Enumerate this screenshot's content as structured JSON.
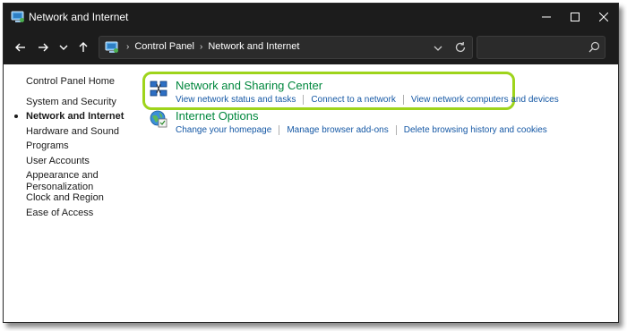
{
  "window": {
    "title": "Network and Internet"
  },
  "address_bar": {
    "crumbs": [
      "Control Panel",
      "Network and Internet"
    ]
  },
  "search": {
    "value": "",
    "placeholder": ""
  },
  "sidebar": {
    "home": "Control Panel Home",
    "items": [
      {
        "label": "System and Security",
        "active": false
      },
      {
        "label": "Network and Internet",
        "active": true
      },
      {
        "label": "Hardware and Sound",
        "active": false
      },
      {
        "label": "Programs",
        "active": false
      },
      {
        "label": "User Accounts",
        "active": false
      },
      {
        "label": "Appearance and Personalization",
        "active": false
      },
      {
        "label": "Clock and Region",
        "active": false
      },
      {
        "label": "Ease of Access",
        "active": false
      }
    ]
  },
  "categories": [
    {
      "title": "Network and Sharing Center",
      "icon": "network-sharing-center-icon",
      "highlighted": true,
      "links": [
        "View network status and tasks",
        "Connect to a network",
        "View network computers and devices"
      ]
    },
    {
      "title": "Internet Options",
      "icon": "internet-options-icon",
      "highlighted": false,
      "links": [
        "Change your homepage",
        "Manage browser add-ons",
        "Delete browsing history and cookies"
      ]
    }
  ],
  "colors": {
    "titlebar_bg": "#1c1c1c",
    "category_title": "#00873d",
    "link": "#1558a5",
    "highlight_ring": "#9ed41b"
  }
}
